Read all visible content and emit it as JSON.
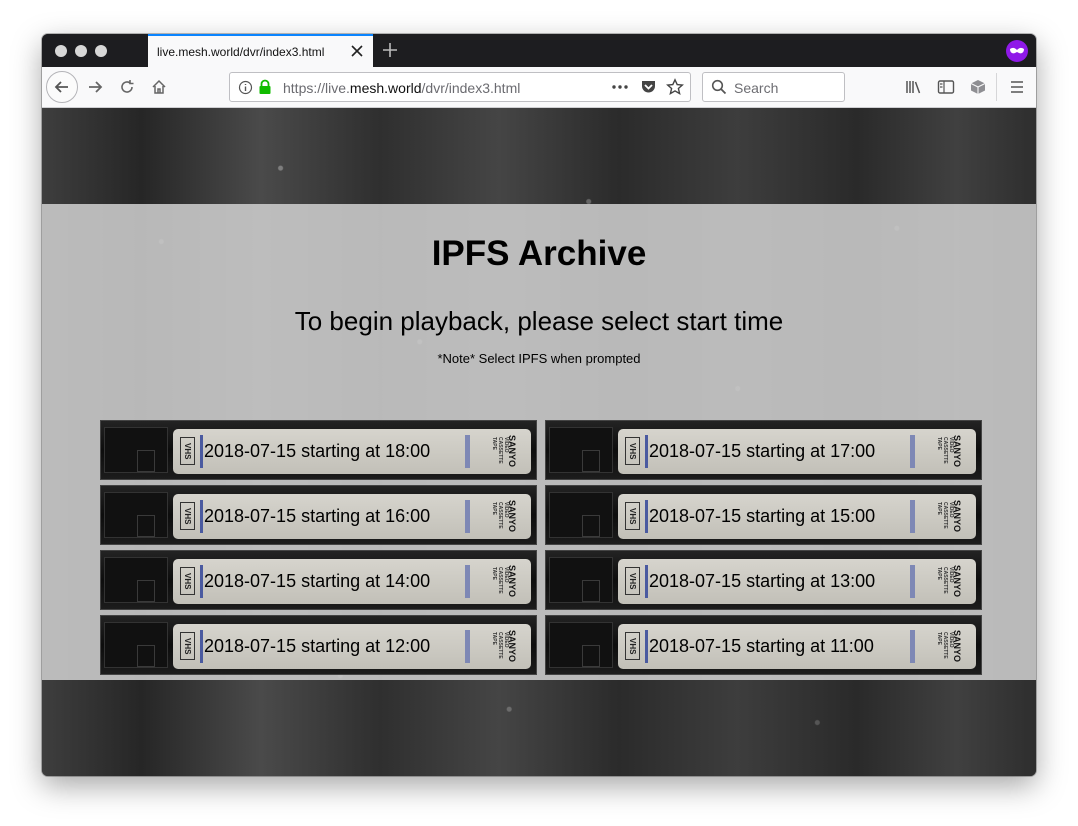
{
  "browser": {
    "tab_title": "live.mesh.world/dvr/index3.html",
    "url_prefix": "https://live.",
    "url_domain": "mesh.world",
    "url_path": "/dvr/index3.html",
    "search_placeholder": "Search",
    "accent_color": "#0a84ff",
    "private_icon_color": "#8f19e8"
  },
  "page": {
    "title": "IPFS Archive",
    "subtitle": "To begin playback, please select start time",
    "note": "*Note* Select IPFS when prompted",
    "tapes": [
      {
        "label": "2018-07-15 starting at 18:00"
      },
      {
        "label": "2018-07-15 starting at 17:00"
      },
      {
        "label": "2018-07-15 starting at 16:00"
      },
      {
        "label": "2018-07-15 starting at 15:00"
      },
      {
        "label": "2018-07-15 starting at 14:00"
      },
      {
        "label": "2018-07-15 starting at 13:00"
      },
      {
        "label": "2018-07-15 starting at 12:00"
      },
      {
        "label": "2018-07-15 starting at 11:00"
      }
    ],
    "tape_logo": "VHS",
    "tape_brand": "SANYO",
    "tape_brand_sub": "VIDEO CASSETTE TAPE"
  }
}
